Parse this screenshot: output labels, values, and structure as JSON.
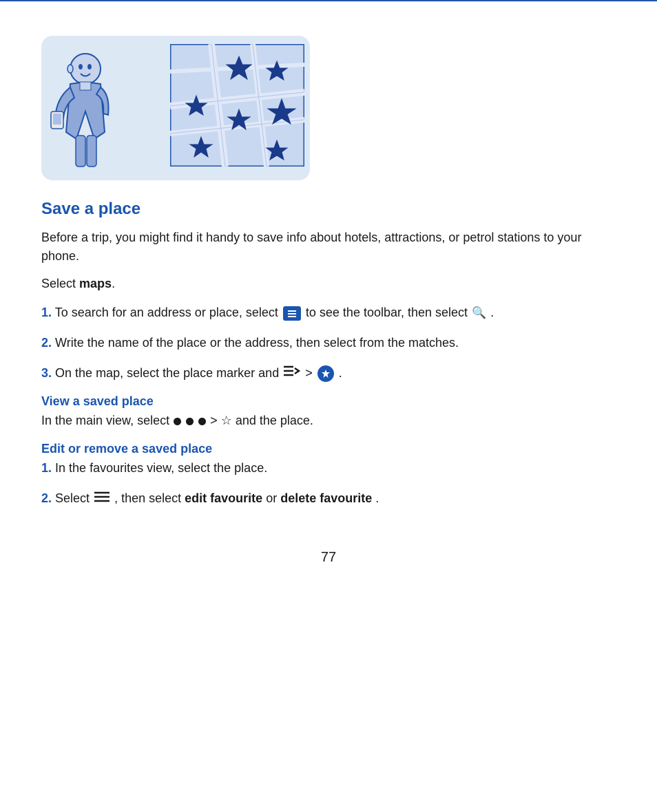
{
  "page": {
    "top_border": true,
    "page_number": "77"
  },
  "illustration": {
    "alt": "Person looking at a map with stars"
  },
  "content": {
    "section_title": "Save a place",
    "intro": "Before a trip, you might find it handy to save info about hotels, attractions, or petrol stations to your phone.",
    "select_maps_prefix": "Select ",
    "select_maps_bold": "maps",
    "select_maps_suffix": ".",
    "steps": [
      {
        "number": "1.",
        "text_before_icon1": " To search for an address or place, select",
        "icon1": "toolbar-icon",
        "text_after_icon1": "to see the toolbar, then select",
        "icon2": "search-icon",
        "text_after_icon2": "."
      },
      {
        "number": "2.",
        "text": " Write the name of the place or the address, then select from the matches."
      },
      {
        "number": "3.",
        "text_before": " On the map, select the place marker and",
        "icon1": "menu-lines-icon",
        "text_middle": ">",
        "icon2": "star-blue-icon",
        "text_after": "."
      }
    ],
    "subsection1": {
      "title": "View a saved place",
      "text_before": "In the main view, select",
      "icon1": "triple-circles-icon",
      "text_middle": ">",
      "icon2": "star-outline-icon",
      "text_after": "and the place."
    },
    "subsection2": {
      "title": "Edit or remove a saved place",
      "step1": {
        "number": "1.",
        "text": " In the favourites view, select the place."
      },
      "step2": {
        "number": "2.",
        "text_before": " Select",
        "icon": "menu-lines-icon",
        "text_middle": ", then select",
        "bold1": "edit favourite",
        "text_or": " or ",
        "bold2": "delete favourite",
        "text_end": "."
      }
    }
  }
}
